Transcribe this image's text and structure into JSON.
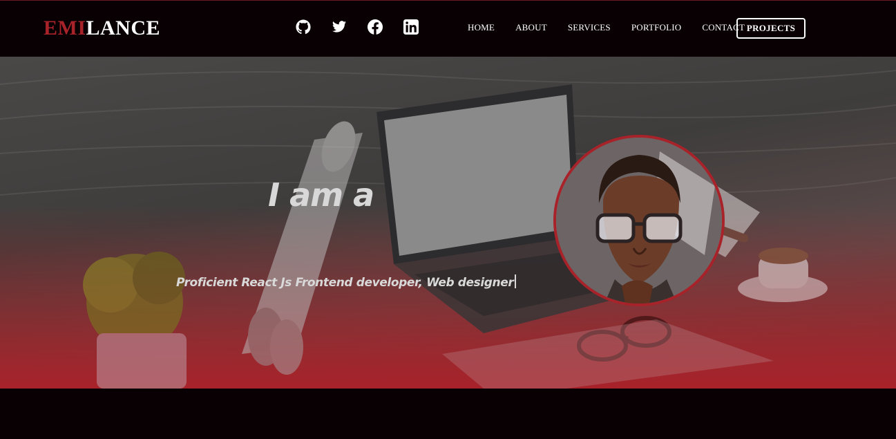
{
  "brand": {
    "part1": "EMI",
    "part2": "LANCE",
    "accent": "#a8222a"
  },
  "socials": [
    {
      "name": "github-icon"
    },
    {
      "name": "twitter-icon"
    },
    {
      "name": "facebook-icon"
    },
    {
      "name": "linkedin-icon"
    }
  ],
  "nav": {
    "items": [
      "HOME",
      "ABOUT",
      "SERVICES",
      "PORTFOLIO",
      "CONTACT"
    ],
    "cta": "PROJECTS"
  },
  "hero": {
    "headline": "I am a",
    "subline": "Proficient React Js Frontend developer, Web designer"
  },
  "colors": {
    "background": "#080002",
    "accent": "#a8222a",
    "text": "#ffffff"
  }
}
